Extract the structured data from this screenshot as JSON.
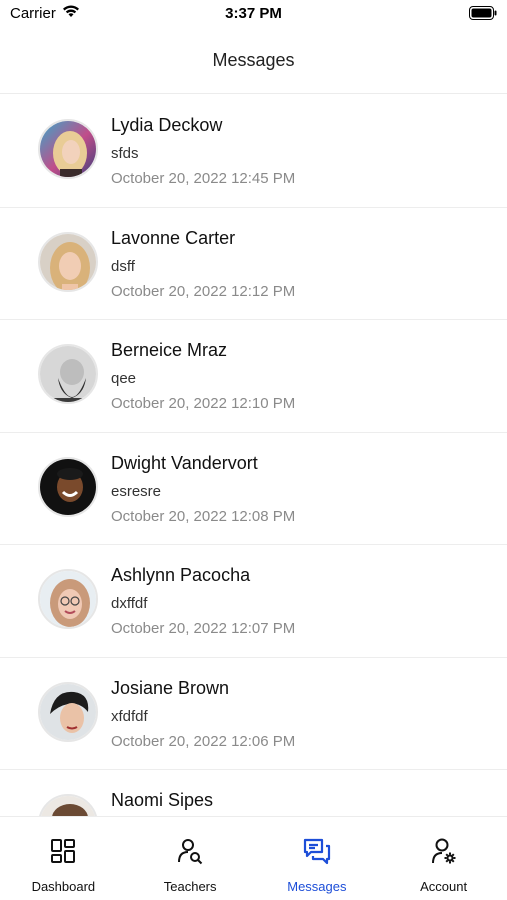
{
  "status_bar": {
    "carrier": "Carrier",
    "time": "3:37 PM"
  },
  "header": {
    "title": "Messages"
  },
  "messages": [
    {
      "name": "Lydia Deckow",
      "preview": "sfds",
      "date": "October 20, 2022 12:45 PM",
      "avatar": "avatar-photo"
    },
    {
      "name": "Lavonne Carter",
      "preview": "dsff",
      "date": "October 20, 2022 12:12 PM",
      "avatar": "avatar-photo"
    },
    {
      "name": "Berneice Mraz",
      "preview": "qee",
      "date": "October 20, 2022 12:10 PM",
      "avatar": "avatar-photo"
    },
    {
      "name": "Dwight Vandervort",
      "preview": "esresre",
      "date": "October 20, 2022 12:08 PM",
      "avatar": "avatar-photo"
    },
    {
      "name": "Ashlynn Pacocha",
      "preview": "dxffdf",
      "date": "October 20, 2022 12:07 PM",
      "avatar": "avatar-photo"
    },
    {
      "name": "Josiane Brown",
      "preview": "xfdfdf",
      "date": "October 20, 2022 12:06 PM",
      "avatar": "avatar-photo"
    },
    {
      "name": "Naomi Sipes",
      "preview": "",
      "date": "",
      "avatar": "avatar-photo"
    }
  ],
  "tabbar": {
    "tabs": [
      {
        "label": "Dashboard",
        "icon": "dashboard-icon",
        "active": false
      },
      {
        "label": "Teachers",
        "icon": "teacher-search-icon",
        "active": false
      },
      {
        "label": "Messages",
        "icon": "messages-icon",
        "active": true
      },
      {
        "label": "Account",
        "icon": "account-settings-icon",
        "active": false
      }
    ]
  },
  "colors": {
    "accent": "#1d4ed8",
    "text": "#111111",
    "muted": "#8a8a8a",
    "divider": "#ececec"
  }
}
